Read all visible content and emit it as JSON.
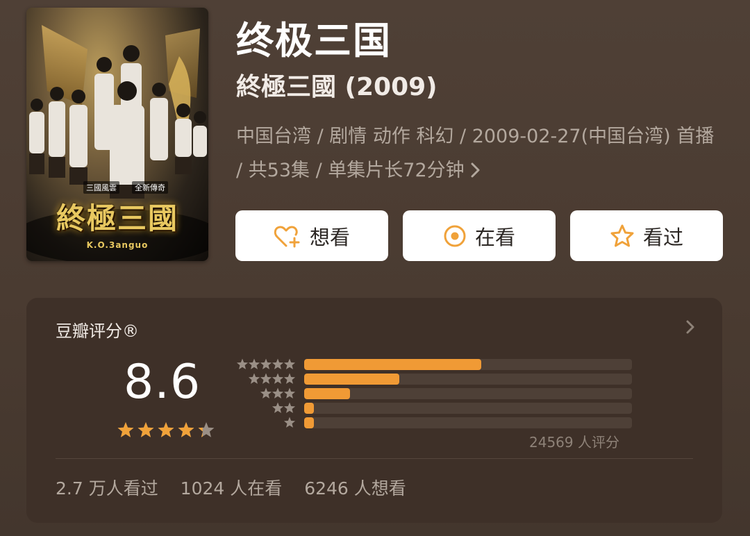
{
  "title": "终极三国",
  "subtitle": "終極三國 (2009)",
  "meta_line": "中国台湾 / 剧情 动作 科幻 / 2009-02-27(中国台湾) 首播 / 共53集 / 单集片长72分钟",
  "poster": {
    "brand": "終極三國",
    "tag_left": "三國風雲",
    "tag_right": "全新傳奇",
    "sub": "K.O.3anguo"
  },
  "actions": {
    "want": {
      "label": "想看",
      "icon": "heart-plus-icon"
    },
    "doing": {
      "label": "在看",
      "icon": "target-circle-icon"
    },
    "done": {
      "label": "看过",
      "icon": "star-outline-icon"
    }
  },
  "rating": {
    "title": "豆瓣评分®",
    "score": "8.6",
    "score_stars_value": 4.3,
    "count_label": "24569 人评分",
    "distribution": [
      {
        "stars": 5,
        "fraction": 0.54
      },
      {
        "stars": 4,
        "fraction": 0.29
      },
      {
        "stars": 3,
        "fraction": 0.14
      },
      {
        "stars": 2,
        "fraction": 0.03
      },
      {
        "stars": 1,
        "fraction": 0.03
      }
    ],
    "stats": {
      "watched": "2.7 万人看过",
      "watching": "1024 人在看",
      "want": "6246 人想看"
    }
  },
  "colors": {
    "accent": "#f09a35",
    "star": "#f0a23a",
    "muted_star": "#9a8f86",
    "background": "#4c3d33",
    "card": "#3e3028"
  }
}
